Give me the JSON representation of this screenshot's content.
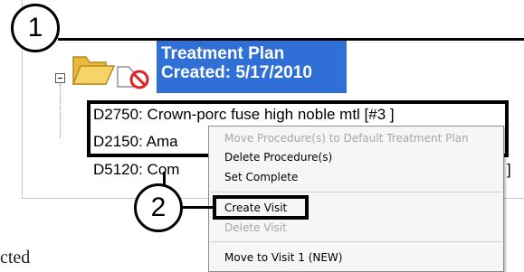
{
  "callouts": {
    "one": "1",
    "two": "2"
  },
  "plan": {
    "title": "Treatment Plan",
    "created": "Created: 5/17/2010"
  },
  "procedures": [
    {
      "text": "D2750: Crown-porc fuse high noble mtl [#3 ]"
    },
    {
      "text": "D2150: Ama"
    },
    {
      "text": "D5120: Com"
    }
  ],
  "trailing_bracket": "]",
  "context_menu": {
    "items": [
      {
        "label": "Move Procedure(s) to Default Treatment Plan",
        "enabled": false
      },
      {
        "label": "Delete Procedure(s)",
        "enabled": true
      },
      {
        "label": "Set Complete",
        "enabled": true
      },
      {
        "label": "Create Visit",
        "enabled": true
      },
      {
        "label": "Delete Visit",
        "enabled": false
      },
      {
        "label": "Move to Visit 1 (NEW)",
        "enabled": true
      }
    ]
  },
  "cut_text": "cted",
  "icons": {
    "collapse": "minus-toggle-icon",
    "folder": "open-folder-icon",
    "no_entry": "no-entry-icon"
  },
  "colors": {
    "header_bg": "#2f6fd6",
    "header_text": "#ffffff",
    "disabled_text": "#a6a6a6"
  }
}
